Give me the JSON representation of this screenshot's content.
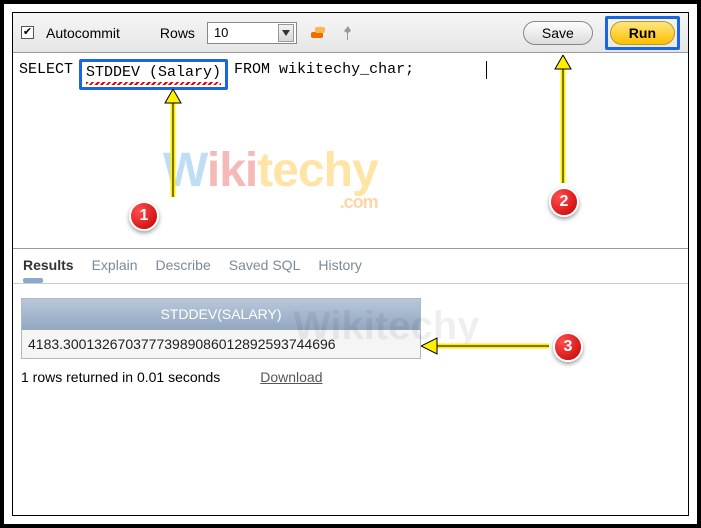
{
  "toolbar": {
    "autocommit_label": "Autocommit",
    "autocommit_checked": true,
    "rows_label": "Rows",
    "rows_value": "10",
    "save_label": "Save",
    "run_label": "Run"
  },
  "sql": {
    "part1": "SELECT ",
    "part2": "STDDEV (Salary)",
    "part3": "FROM wikitechy_char;"
  },
  "tabs": {
    "results": "Results",
    "explain": "Explain",
    "describe": "Describe",
    "saved_sql": "Saved SQL",
    "history": "History"
  },
  "results": {
    "header": "STDDEV(SALARY)",
    "value": "4183.30013267037773989086012892593744696",
    "status": "1 rows returned in 0.01 seconds",
    "download": "Download"
  },
  "watermark": {
    "w": "W",
    "iki": "iki",
    "techy": "techy",
    "com": ".com"
  },
  "annotations": {
    "b1": "1",
    "b2": "2",
    "b3": "3"
  }
}
